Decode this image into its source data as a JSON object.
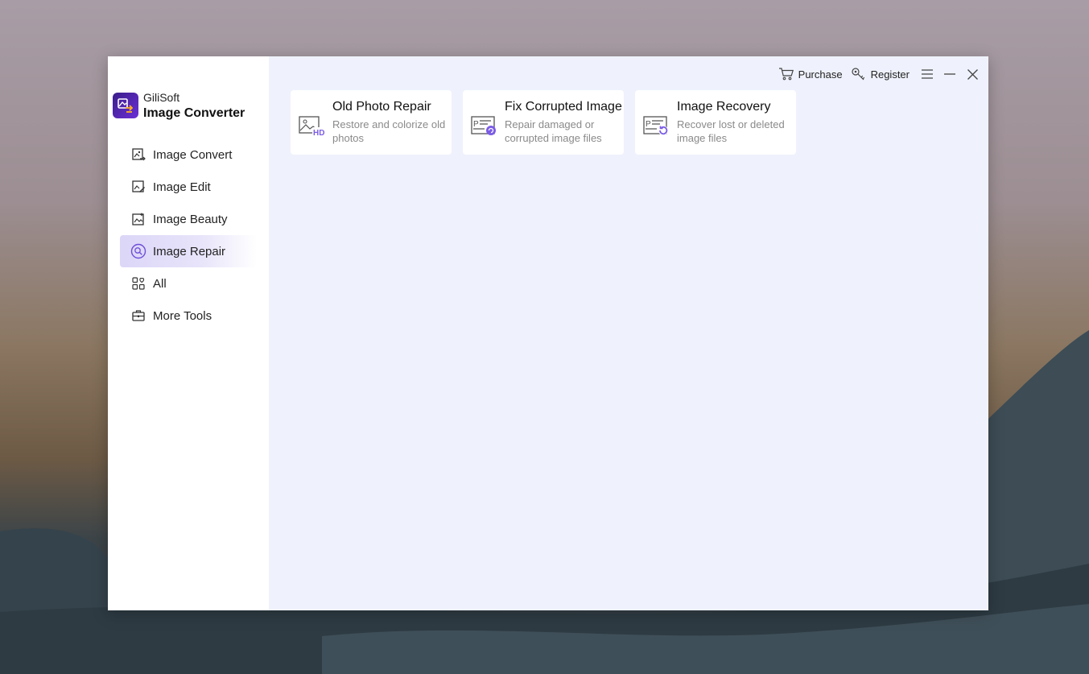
{
  "app": {
    "brand": "GiliSoft",
    "product": "Image Converter"
  },
  "topbar": {
    "purchase_label": "Purchase",
    "register_label": "Register"
  },
  "sidebar": {
    "items": [
      {
        "label": "Image Convert",
        "icon": "image-convert-icon"
      },
      {
        "label": "Image Edit",
        "icon": "image-edit-icon"
      },
      {
        "label": "Image Beauty",
        "icon": "image-beauty-icon"
      },
      {
        "label": "Image Repair",
        "icon": "image-repair-icon",
        "active": true
      },
      {
        "label": "All",
        "icon": "all-grid-icon"
      },
      {
        "label": "More Tools",
        "icon": "toolbox-icon"
      }
    ]
  },
  "cards": [
    {
      "title": "Old Photo Repair",
      "desc": "Restore and colorize old photos",
      "icon": "hd-photo-icon"
    },
    {
      "title": "Fix Corrupted Image",
      "desc": "Repair damaged or corrupted image files",
      "icon": "fix-image-icon"
    },
    {
      "title": "Image Recovery",
      "desc": "Recover lost or deleted image files",
      "icon": "recover-image-icon"
    }
  ],
  "colors": {
    "accent": "#7b5ce6",
    "sidebar_active": "#dcd6f7",
    "main_bg": "#eff2fc"
  }
}
